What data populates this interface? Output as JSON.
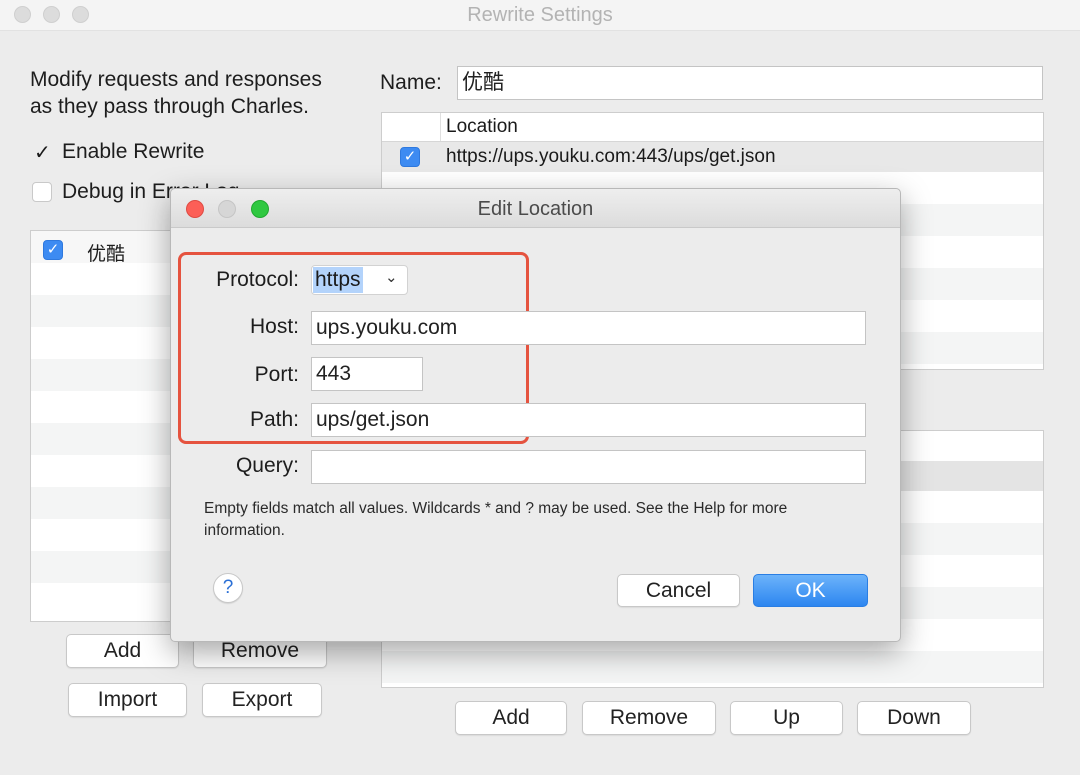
{
  "main": {
    "title": "Rewrite Settings",
    "description_line1": "Modify requests and responses",
    "description_line2": "as they pass through Charles.",
    "enable_rewrite_label": "Enable Rewrite",
    "debug_label": "Debug in Error Log",
    "rule_sets": [
      {
        "name": "优酷",
        "checked": true
      }
    ],
    "left_buttons": {
      "add": "Add",
      "remove": "Remove",
      "import": "Import",
      "export": "Export"
    },
    "name_label": "Name:",
    "name_value": "优酷",
    "locations_header": "Location",
    "locations": [
      {
        "url": "https://ups.youku.com:443/ups/get.json",
        "checked": true
      }
    ],
    "bottom_buttons": {
      "add": "Add",
      "remove": "Remove",
      "up": "Up",
      "down": "Down"
    }
  },
  "dialog": {
    "title": "Edit Location",
    "protocol_label": "Protocol:",
    "protocol_value": "https",
    "host_label": "Host:",
    "host_value": "ups.youku.com",
    "port_label": "Port:",
    "port_value": "443",
    "path_label": "Path:",
    "path_value": "ups/get.json",
    "query_label": "Query:",
    "query_value": "",
    "help_text_line1": "Empty fields match all values. Wildcards * and ? may be used. See the Help for more",
    "help_text_line2": "information.",
    "help_icon": "?",
    "cancel_label": "Cancel",
    "ok_label": "OK"
  },
  "colors": {
    "accent": "#3d8bf2",
    "highlight_border": "#e5533f",
    "close_light": "#fc5f57",
    "zoom_light": "#2fc840"
  }
}
